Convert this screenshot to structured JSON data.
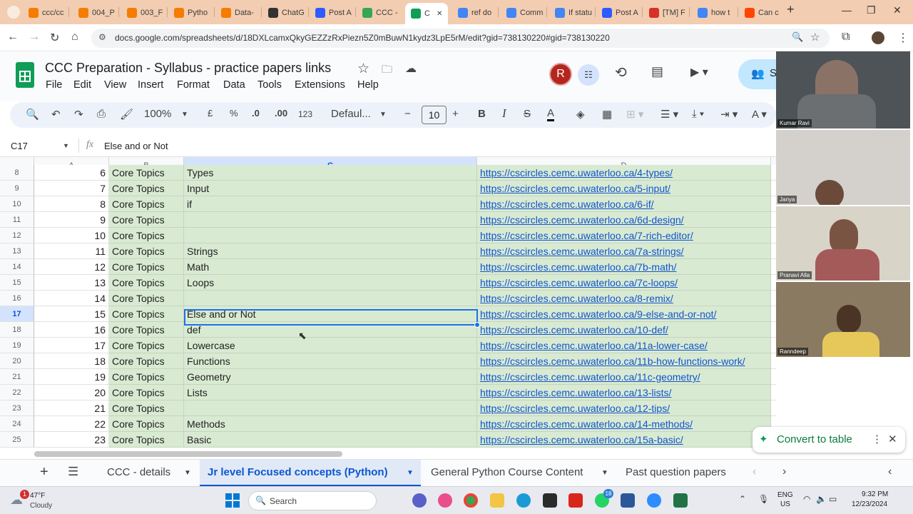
{
  "browser": {
    "tabs": [
      {
        "label": "ccc/cc",
        "color": "#f57c00"
      },
      {
        "label": "004_P",
        "color": "#f57c00"
      },
      {
        "label": "003_F",
        "color": "#f57c00"
      },
      {
        "label": "Pytho",
        "color": "#f57c00"
      },
      {
        "label": "Data-",
        "color": "#f57c00"
      },
      {
        "label": "ChatG",
        "color": "#333333"
      },
      {
        "label": "Post A",
        "color": "#2d5bff"
      },
      {
        "label": "CCC -",
        "color": "#34a853"
      },
      {
        "label": "C",
        "color": "#0f9d58"
      },
      {
        "label": "ref do",
        "color": "#4285f4"
      },
      {
        "label": "Comm",
        "color": "#4285f4"
      },
      {
        "label": "If statu",
        "color": "#4285f4"
      },
      {
        "label": "Post A",
        "color": "#2d5bff"
      },
      {
        "label": "[TM] F",
        "color": "#d93025"
      },
      {
        "label": "how t",
        "color": "#4285f4"
      },
      {
        "label": "Can c",
        "color": "#ff4500"
      }
    ],
    "url": "docs.google.com/spreadsheets/d/18DXLcamxQkyGEZZzRxPiezn5Z0mBuwN1kydz3LpE5rM/edit?gid=738130220#gid=738130220"
  },
  "sheet": {
    "title": "CCC Preparation - Syllabus - practice papers links",
    "menu": [
      "File",
      "Edit",
      "View",
      "Insert",
      "Format",
      "Data",
      "Tools",
      "Extensions",
      "Help"
    ],
    "avatar_letter": "R",
    "share_label": "S",
    "toolbar": {
      "zoom": "100%",
      "currency": "£",
      "percent": "%",
      "dec_less": ".0",
      "dec_more": ".00",
      "number_format": "123",
      "font": "Defaul...",
      "font_size": "10"
    },
    "name_box": "C17",
    "formula": "Else and or Not",
    "columns": [
      "A",
      "B",
      "C",
      "D"
    ],
    "rows": [
      {
        "n": "8",
        "a": "6",
        "b": "Core Topics",
        "c": "Types",
        "d": "https://cscircles.cemc.uwaterloo.ca/4-types/"
      },
      {
        "n": "9",
        "a": "7",
        "b": "Core Topics",
        "c": "Input",
        "d": "https://cscircles.cemc.uwaterloo.ca/5-input/"
      },
      {
        "n": "10",
        "a": "8",
        "b": "Core Topics",
        "c": "if",
        "d": "https://cscircles.cemc.uwaterloo.ca/6-if/"
      },
      {
        "n": "11",
        "a": "9",
        "b": "Core Topics",
        "c": "",
        "d": "https://cscircles.cemc.uwaterloo.ca/6d-design/"
      },
      {
        "n": "12",
        "a": "10",
        "b": "Core Topics",
        "c": "",
        "d": "https://cscircles.cemc.uwaterloo.ca/7-rich-editor/"
      },
      {
        "n": "13",
        "a": "11",
        "b": "Core Topics",
        "c": "Strings",
        "d": "https://cscircles.cemc.uwaterloo.ca/7a-strings/"
      },
      {
        "n": "14",
        "a": "12",
        "b": "Core Topics",
        "c": "Math",
        "d": "https://cscircles.cemc.uwaterloo.ca/7b-math/"
      },
      {
        "n": "15",
        "a": "13",
        "b": "Core Topics",
        "c": "Loops",
        "d": "https://cscircles.cemc.uwaterloo.ca/7c-loops/"
      },
      {
        "n": "16",
        "a": "14",
        "b": "Core Topics",
        "c": "",
        "d": "https://cscircles.cemc.uwaterloo.ca/8-remix/"
      },
      {
        "n": "17",
        "a": "15",
        "b": "Core Topics",
        "c": "Else and or Not",
        "d": "https://cscircles.cemc.uwaterloo.ca/9-else-and-or-not/"
      },
      {
        "n": "18",
        "a": "16",
        "b": "Core Topics",
        "c": "def",
        "d": "https://cscircles.cemc.uwaterloo.ca/10-def/"
      },
      {
        "n": "19",
        "a": "17",
        "b": "Core Topics",
        "c": "Lowercase",
        "d": "https://cscircles.cemc.uwaterloo.ca/11a-lower-case/"
      },
      {
        "n": "20",
        "a": "18",
        "b": "Core Topics",
        "c": "Functions",
        "d": "https://cscircles.cemc.uwaterloo.ca/11b-how-functions-work/"
      },
      {
        "n": "21",
        "a": "19",
        "b": "Core Topics",
        "c": "Geometry",
        "d": "https://cscircles.cemc.uwaterloo.ca/11c-geometry/"
      },
      {
        "n": "22",
        "a": "20",
        "b": "Core Topics",
        "c": "Lists",
        "d": "https://cscircles.cemc.uwaterloo.ca/13-lists/"
      },
      {
        "n": "23",
        "a": "21",
        "b": "Core Topics",
        "c": "",
        "d": "https://cscircles.cemc.uwaterloo.ca/12-tips/"
      },
      {
        "n": "24",
        "a": "22",
        "b": "Core Topics",
        "c": "Methods",
        "d": "https://cscircles.cemc.uwaterloo.ca/14-methods/"
      },
      {
        "n": "25",
        "a": "23",
        "b": "Core Topics",
        "c": "Basic",
        "d": "https://cscircles.cemc.uwaterloo.ca/15a-basic/"
      }
    ],
    "sheet_tabs": [
      "CCC - details",
      "Jr level Focused concepts (Python)",
      "General Python Course Content",
      "Past question papers"
    ],
    "active_sheet_tab": "Jr level Focused concepts (Python)",
    "convert_label": "Convert to table"
  },
  "participants": [
    "Kumar Ravi",
    "Janya",
    "Pranavi Alla",
    "Ranndeep"
  ],
  "taskbar": {
    "weather_temp": "47°F",
    "weather_desc": "Cloudy",
    "weather_badge": "1",
    "search_label": "Search",
    "lang_top": "ENG",
    "lang_bottom": "US",
    "time": "9:32 PM",
    "date": "12/23/2024",
    "whatsapp_badge": "18"
  },
  "colors": {
    "tabstrip": "#f3cdb1",
    "green_fill": "#d9ead3",
    "link": "#1155cc",
    "selection": "#1a73e8",
    "sheets_green": "#0f9d58"
  }
}
